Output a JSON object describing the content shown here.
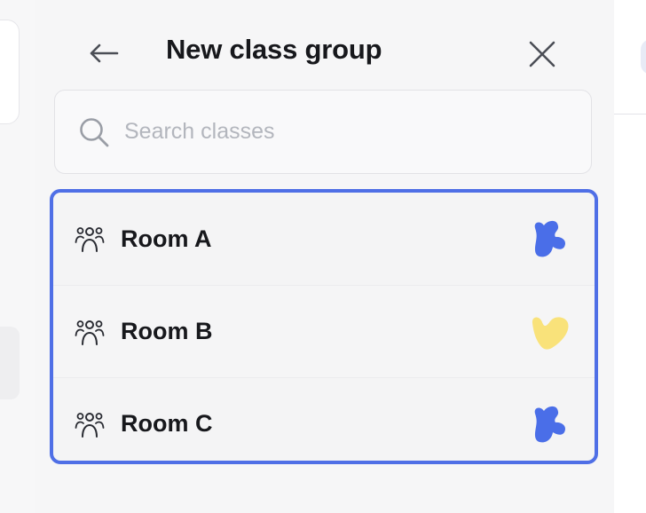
{
  "header": {
    "title": "New class group",
    "back_icon": "arrow-left-icon",
    "close_icon": "close-icon"
  },
  "search": {
    "placeholder": "Search classes",
    "value": "",
    "icon": "search-icon"
  },
  "classes": [
    {
      "label": "Room A",
      "icon": "group-icon",
      "badge_icon": "blue-blob-icon",
      "badge_color": "#4a6ee8"
    },
    {
      "label": "Room B",
      "icon": "group-icon",
      "badge_icon": "yellow-heart-icon",
      "badge_color": "#f9e27a"
    },
    {
      "label": "Room C",
      "icon": "group-icon",
      "badge_icon": "blue-blob-icon",
      "badge_color": "#4a6ee8"
    }
  ],
  "colors": {
    "accent": "#4f6fe6",
    "text": "#17181c",
    "placeholder": "#b3b6bd",
    "panel_bg": "#f6f6f7"
  }
}
